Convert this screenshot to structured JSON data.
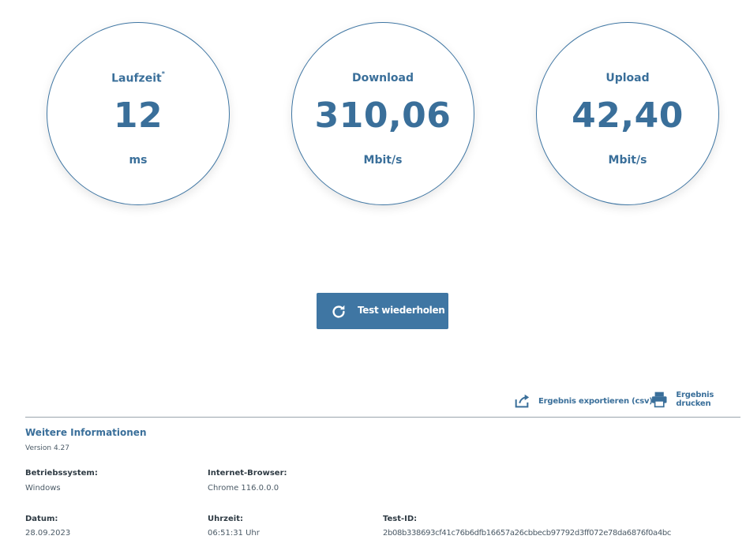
{
  "colors": {
    "accent": "#3f76a3",
    "text_primary": "#3a6f9a",
    "divider": "#9aa4ad"
  },
  "gauges": {
    "latency": {
      "label": "Laufzeit",
      "marker": "*",
      "value": "12",
      "unit": "ms"
    },
    "download": {
      "label": "Download",
      "value": "310,06",
      "unit": "Mbit/s"
    },
    "upload": {
      "label": "Upload",
      "value": "42,40",
      "unit": "Mbit/s"
    }
  },
  "actions": {
    "repeat_label": "Test wiederholen",
    "repeat_icon": "refresh-icon",
    "export_label": "Ergebnis exportieren (csv)",
    "export_icon": "export-icon",
    "print_label": "Ergebnis drucken",
    "print_icon": "printer-icon"
  },
  "info": {
    "title": "Weitere Informationen",
    "version": "Version 4.27",
    "os_label": "Betriebssystem:",
    "os_value": "Windows",
    "browser_label": "Internet-Browser:",
    "browser_value": "Chrome 116.0.0.0",
    "date_label": "Datum:",
    "date_value": "28.09.2023",
    "time_label": "Uhrzeit:",
    "time_value": "06:51:31 Uhr",
    "testid_label": "Test-ID:",
    "testid_value": "2b08b338693cf41c76b6dfb16657a26cbbecb97792d3ff072e78da6876f0a4bc"
  }
}
